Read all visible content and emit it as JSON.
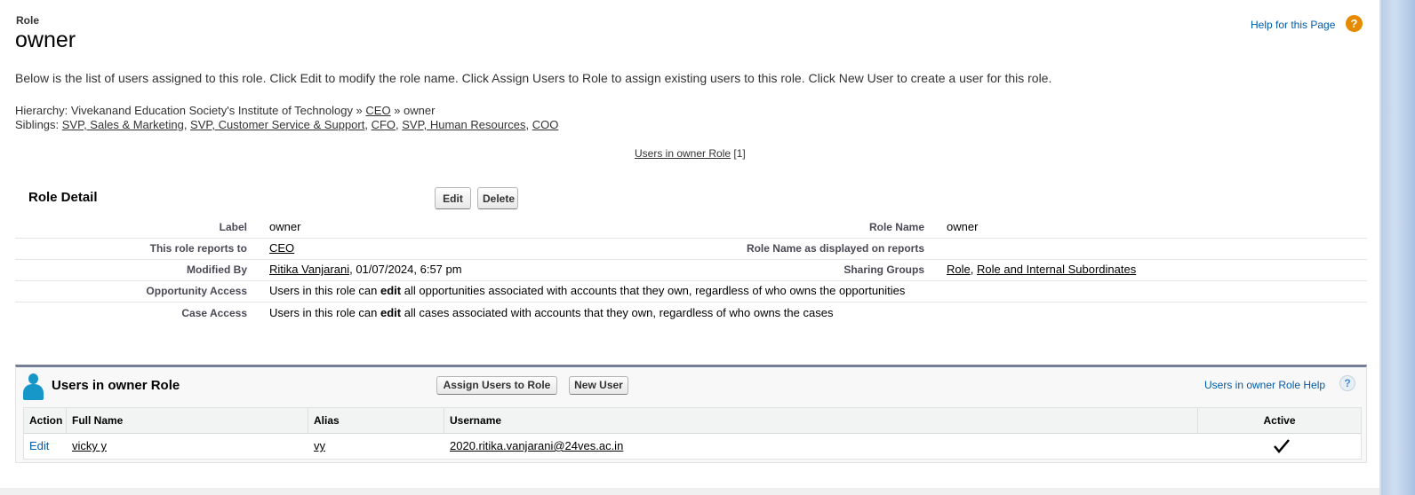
{
  "header": {
    "object_type": "Role",
    "title": "owner",
    "help_link": "Help for this Page",
    "help_icon": "question-circle-icon"
  },
  "intro_text": "Below is the list of users assigned to this role. Click Edit to modify the role name. Click Assign Users to Role to assign existing users to this role. Click New User to create a user for this role.",
  "hierarchy": {
    "prefix": "Hierarchy: Vivekanand Education Society's Institute of Technology » ",
    "ceo": "CEO",
    "suffix": " » owner"
  },
  "siblings": {
    "prefix": "Siblings: ",
    "items": [
      "SVP, Sales & Marketing",
      "SVP, Customer Service & Support",
      "CFO",
      "SVP, Human Resources",
      "COO"
    ],
    "separator": ", "
  },
  "users_link": {
    "label": "Users in owner Role",
    "count": "[1]"
  },
  "role_detail": {
    "title": "Role Detail",
    "edit_button": "Edit",
    "delete_button": "Delete",
    "label_label": "Label",
    "label_value": "owner",
    "role_name_label": "Role Name",
    "role_name_value": "owner",
    "reports_to_label": "This role reports to",
    "reports_to_value": "CEO",
    "displayed_label": "Role Name as displayed on reports",
    "modified_by_label": "Modified By",
    "modified_by_user": "Ritika Vanjarani",
    "modified_by_date": ", 01/07/2024, 6:57 pm",
    "sharing_groups_label": "Sharing Groups",
    "sharing_group_1": "Role",
    "sharing_group_sep": ", ",
    "sharing_group_2": "Role and Internal Subordinates",
    "opportunity_label": "Opportunity Access",
    "opportunity_pre": "Users in this role can ",
    "opportunity_bold": "edit",
    "opportunity_post": " all opportunities associated with accounts that they own, regardless of who owns the opportunities",
    "case_label": "Case Access",
    "case_pre": "Users in this role can ",
    "case_bold": "edit",
    "case_post": " all cases associated with accounts that they own, regardless of who owns the cases"
  },
  "related_list": {
    "title": "Users in owner Role",
    "icon": "user-icon",
    "assign_button": "Assign Users to Role",
    "new_user_button": "New User",
    "help_link": "Users in owner Role Help",
    "help_icon": "question-icon",
    "columns": [
      "Action",
      "Full Name",
      "Alias",
      "Username",
      "Active"
    ],
    "rows": [
      {
        "action": "Edit",
        "full_name": "vicky y",
        "alias": "vy",
        "username": "2020.ritika.vanjarani@24ves.ac.in",
        "active": true
      }
    ]
  },
  "colors": {
    "link_blue": "#015ba7",
    "help_orange": "#e68a00",
    "person_icon": "#1796c8",
    "related_list_border": "#747e96"
  }
}
